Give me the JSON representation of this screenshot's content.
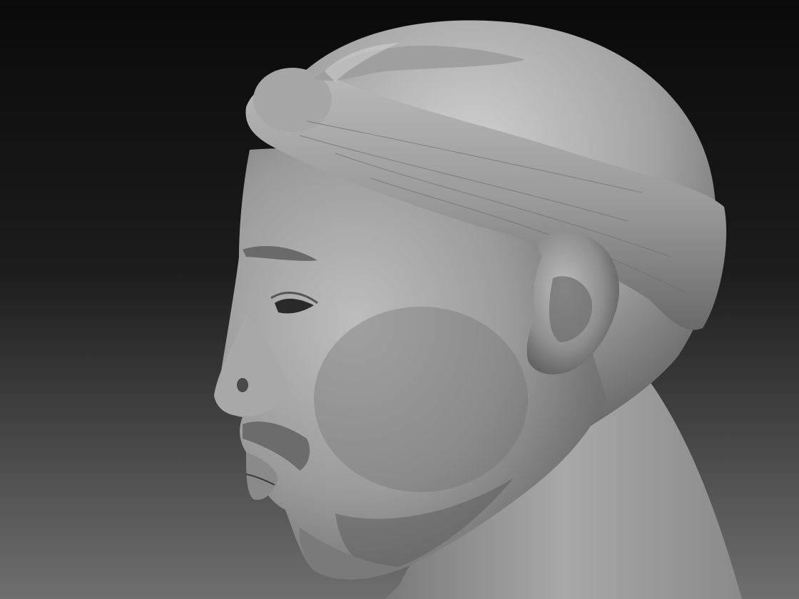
{
  "scene": {
    "subject": "sculpted-head-bust",
    "view": "left-profile",
    "material": "matte-grey-clay",
    "background_gradient": [
      "#0a0a0a",
      "#1c1c1c",
      "#6f6f6f"
    ],
    "material_colors": {
      "highlight": "#c9c9c9",
      "mid": "#9a9a9a",
      "shadow": "#4a4a4a",
      "deep_shadow": "#2a2a2a"
    }
  }
}
